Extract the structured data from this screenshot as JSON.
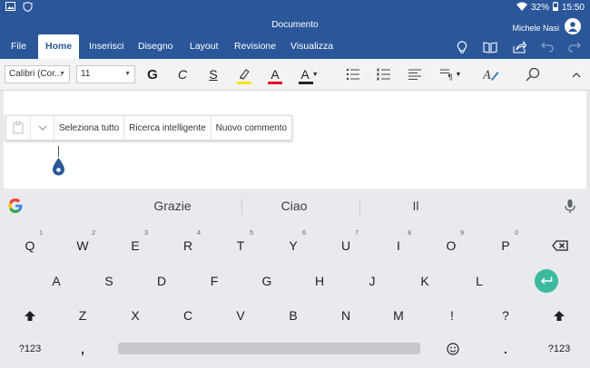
{
  "status": {
    "battery": "32%",
    "time": "15:50"
  },
  "titlebar": {
    "title": "Documento",
    "user": "Michele Nasi"
  },
  "ribbon": {
    "tabs": [
      "File",
      "Home",
      "Inserisci",
      "Disegno",
      "Layout",
      "Revisione",
      "Visualizza"
    ],
    "active_tab": "Home"
  },
  "toolbar": {
    "font_name": "Calibri (Cor...",
    "font_size": "11",
    "bold_label": "G",
    "italic_label": "C",
    "underline_label": "S",
    "font_color_label": "A",
    "highlight_color": "#f5e51a",
    "font_color": "#e81123",
    "text_effect_color": "#222222"
  },
  "context_menu": {
    "items": [
      "Seleziona tutto",
      "Ricerca intelligente",
      "Nuovo commento"
    ]
  },
  "keyboard": {
    "suggestions": [
      "Grazie",
      "Ciao",
      "Il"
    ],
    "row1": [
      {
        "k": "Q",
        "h": "1"
      },
      {
        "k": "W",
        "h": "2"
      },
      {
        "k": "E",
        "h": "3"
      },
      {
        "k": "R",
        "h": "4"
      },
      {
        "k": "T",
        "h": "5"
      },
      {
        "k": "Y",
        "h": "6"
      },
      {
        "k": "U",
        "h": "7"
      },
      {
        "k": "I",
        "h": "8"
      },
      {
        "k": "O",
        "h": "9"
      },
      {
        "k": "P",
        "h": "0"
      }
    ],
    "row2": [
      "A",
      "S",
      "D",
      "F",
      "G",
      "H",
      "J",
      "K",
      "L"
    ],
    "row3": [
      "Z",
      "X",
      "C",
      "V",
      "B",
      "N",
      "M",
      "!",
      "?"
    ],
    "sym_label": "?123",
    "comma": ",",
    "period": "."
  }
}
